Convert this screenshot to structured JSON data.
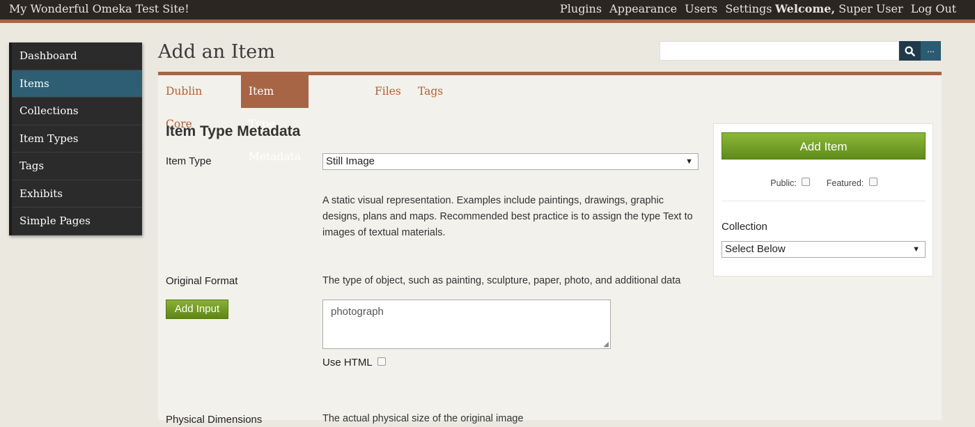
{
  "site_title": "My Wonderful Omeka Test Site!",
  "global_nav": [
    "Plugins",
    "Appearance",
    "Users",
    "Settings"
  ],
  "user_nav": {
    "welcome": "Welcome,",
    "user": "Super User",
    "logout": "Log Out"
  },
  "sidebar": {
    "items": [
      {
        "label": "Dashboard",
        "active": false
      },
      {
        "label": "Items",
        "active": true
      },
      {
        "label": "Collections",
        "active": false
      },
      {
        "label": "Item Types",
        "active": false
      },
      {
        "label": "Tags",
        "active": false
      },
      {
        "label": "Exhibits",
        "active": false
      },
      {
        "label": "Simple Pages",
        "active": false
      }
    ]
  },
  "page_title": "Add an Item",
  "search": {
    "value": "",
    "search_icon": "search-icon",
    "advanced_label": "..."
  },
  "tabs": [
    {
      "label": "Dublin Core",
      "active": false
    },
    {
      "label": "Item Type Metadata",
      "active": true
    },
    {
      "label": "Files",
      "active": false
    },
    {
      "label": "Tags",
      "active": false
    }
  ],
  "form": {
    "heading": "Item Type Metadata",
    "item_type": {
      "label": "Item Type",
      "selected": "Still Image",
      "description": "A static visual representation. Examples include paintings, drawings, graphic designs, plans and maps. Recommended best practice is to assign the type Text to images of textual materials."
    },
    "original_format": {
      "label": "Original Format",
      "description": "The type of object, such as painting, sculpture, paper, photo, and additional data",
      "add_input_label": "Add Input",
      "value": "photograph",
      "use_html_label": "Use HTML"
    },
    "physical_dimensions": {
      "label": "Physical Dimensions",
      "description": "The actual physical size of the original image"
    }
  },
  "panel": {
    "add_item_label": "Add Item",
    "public_label": "Public:",
    "featured_label": "Featured:",
    "collection_label": "Collection",
    "collection_selected": "Select Below"
  },
  "colors": {
    "topbar_bg": "#2b2622",
    "accent_rust": "#a86545",
    "sidebar_bg": "#2b2b2b",
    "sidebar_active": "#2e5e74",
    "green_button": "#6f9a22",
    "search_button": "#1f3a4a"
  }
}
